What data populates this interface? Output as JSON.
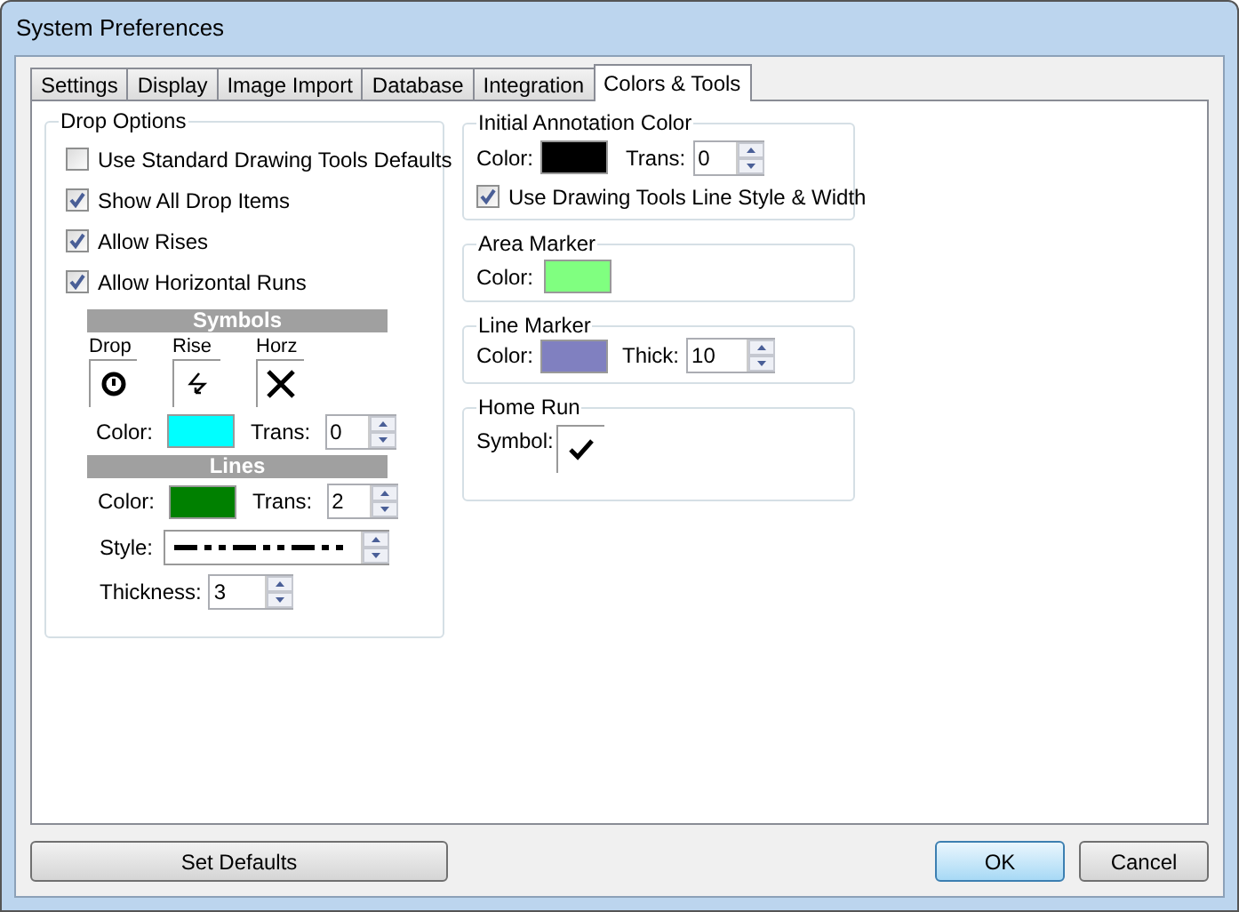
{
  "window": {
    "title": "System Preferences"
  },
  "tabs": [
    {
      "label": "Settings",
      "selected": false
    },
    {
      "label": "Display",
      "selected": false
    },
    {
      "label": "Image Import",
      "selected": false
    },
    {
      "label": "Database",
      "selected": false
    },
    {
      "label": "Integration",
      "selected": false
    },
    {
      "label": "Colors & Tools",
      "selected": true
    }
  ],
  "drop_options": {
    "title": "Drop Options",
    "checkboxes": [
      {
        "label": "Use Standard Drawing Tools Defaults",
        "checked": false
      },
      {
        "label": "Show All Drop Items",
        "checked": true
      },
      {
        "label": "Allow Rises",
        "checked": true
      },
      {
        "label": "Allow Horizontal Runs",
        "checked": true
      }
    ],
    "symbols": {
      "title": "Symbols",
      "items": [
        {
          "label": "Drop"
        },
        {
          "label": "Rise"
        },
        {
          "label": "Horz"
        }
      ],
      "color_label": "Color:",
      "color": "#00ffff",
      "trans_label": "Trans:",
      "trans": "0"
    },
    "lines": {
      "title": "Lines",
      "color_label": "Color:",
      "color": "#008000",
      "trans_label": "Trans:",
      "trans": "2",
      "style_label": "Style:",
      "thickness_label": "Thickness:",
      "thickness": "3"
    }
  },
  "initial_annotation_color": {
    "title": "Initial Annotation Color",
    "color_label": "Color:",
    "color": "#000000",
    "trans_label": "Trans:",
    "trans": "0",
    "checkbox": {
      "label": "Use Drawing Tools Line Style & Width",
      "checked": true
    }
  },
  "area_marker": {
    "title": "Area Marker",
    "color_label": "Color:",
    "color": "#80ff80"
  },
  "line_marker": {
    "title": "Line Marker",
    "color_label": "Color:",
    "color": "#8080c0",
    "thick_label": "Thick:",
    "thick": "10"
  },
  "home_run": {
    "title": "Home Run",
    "symbol_label": "Symbol:"
  },
  "buttons": {
    "set_defaults": "Set Defaults",
    "ok": "OK",
    "cancel": "Cancel"
  }
}
